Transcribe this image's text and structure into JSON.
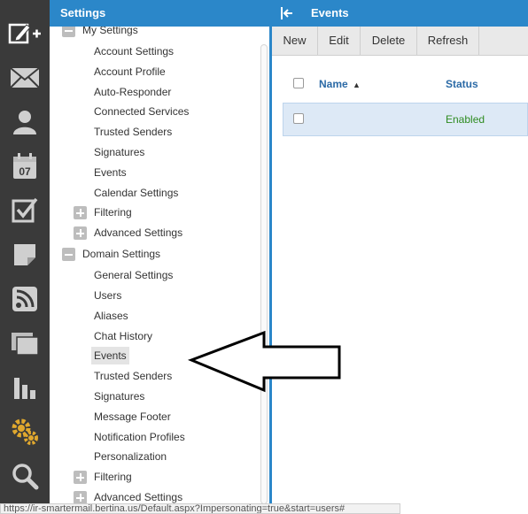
{
  "rail": {
    "icons": [
      "compose-icon",
      "mail-icon",
      "contacts-icon",
      "calendar-icon",
      "tasks-icon",
      "notes-icon",
      "rss-icon",
      "files-icon",
      "reports-icon",
      "settings-icon",
      "search-icon"
    ],
    "calendar_day": "07"
  },
  "settings": {
    "title": "Settings",
    "my_settings": {
      "label": "My Settings",
      "items": [
        "Account Settings",
        "Account Profile",
        "Auto-Responder",
        "Connected Services",
        "Trusted Senders",
        "Signatures",
        "Events",
        "Calendar Settings"
      ],
      "filtering": "Filtering",
      "advanced": "Advanced Settings"
    },
    "domain_settings": {
      "label": "Domain Settings",
      "items": [
        "General Settings",
        "Users",
        "Aliases",
        "Chat History",
        "Events",
        "Trusted Senders",
        "Signatures",
        "Message Footer",
        "Notification Profiles",
        "Personalization"
      ],
      "selected": "Events",
      "filtering": "Filtering",
      "advanced": "Advanced Settings"
    }
  },
  "events": {
    "title": "Events",
    "toolbar": {
      "new": "New",
      "edit": "Edit",
      "delete": "Delete",
      "refresh": "Refresh"
    },
    "columns": {
      "name": "Name",
      "status": "Status"
    },
    "sort_indicator": "▲",
    "rows": [
      {
        "name": "",
        "status": "Enabled"
      }
    ]
  },
  "statusbar": {
    "url": "https://ir-smartermail.bertina.us/Default.aspx?Impersonating=true&start=users#"
  },
  "colors": {
    "header_blue": "#2b87c9",
    "rail_bg": "#3a3a3a",
    "selected_row": "#dde9f6",
    "status_enabled": "#2e8b20",
    "settings_gold": "#e0a82e"
  }
}
